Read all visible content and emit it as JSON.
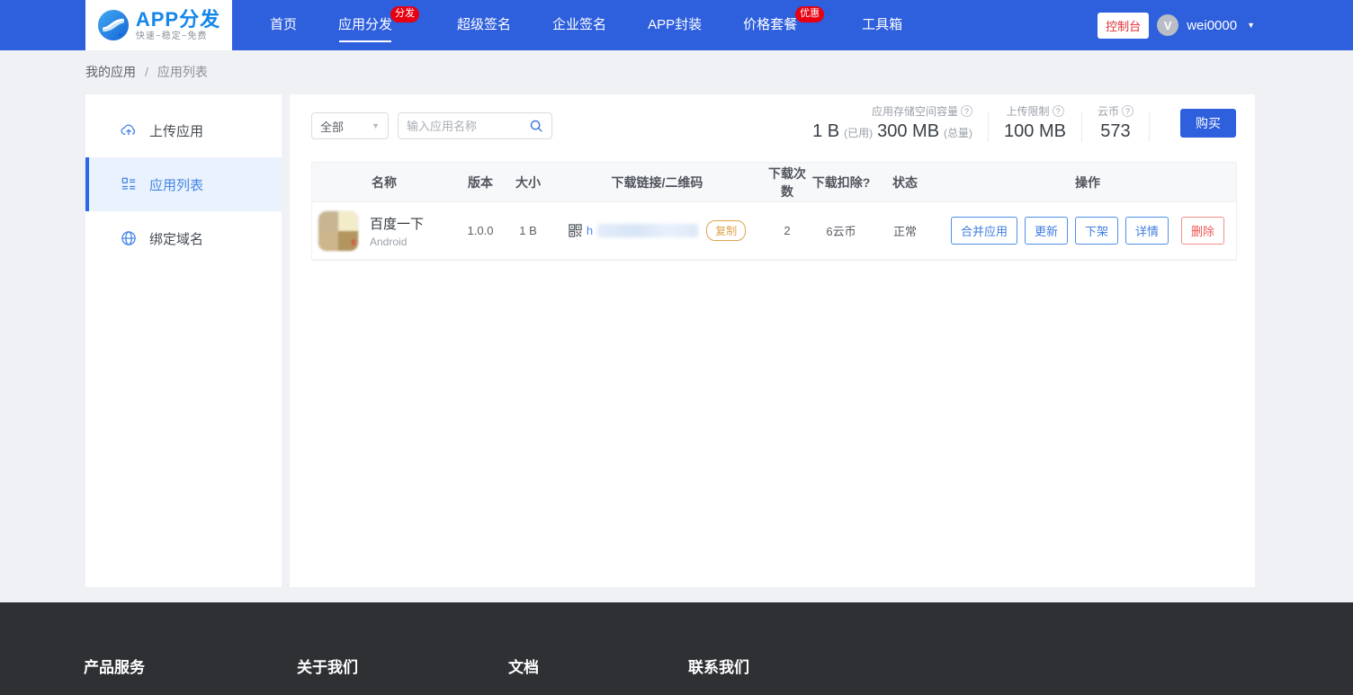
{
  "header": {
    "logo": {
      "title": "APP分发",
      "tagline": "快速~稳定~免费"
    },
    "nav": {
      "items": [
        {
          "label": "首页"
        },
        {
          "label": "应用分发",
          "badge": "分发"
        },
        {
          "label": "超级签名"
        },
        {
          "label": "企业签名"
        },
        {
          "label": "APP封装"
        },
        {
          "label": "价格套餐",
          "badge": "优惠"
        },
        {
          "label": "工具箱"
        }
      ]
    },
    "console_button": "控制台",
    "user": {
      "name": "wei0000",
      "avatar_initial": "V"
    }
  },
  "breadcrumb": {
    "current": "我的应用",
    "separator": "/",
    "page": "应用列表"
  },
  "sidebar": {
    "items": [
      {
        "label": "上传应用"
      },
      {
        "label": "应用列表"
      },
      {
        "label": "绑定域名"
      }
    ]
  },
  "toolbar": {
    "filter_selected": "全部",
    "search_placeholder": "输入应用名称"
  },
  "stats": {
    "storage_label": "应用存储空间容量",
    "used_value": "1 B",
    "used_suffix": "(已用)",
    "total_value": "300 MB",
    "total_suffix": "(总量)",
    "upload_limit_label": "上传限制",
    "upload_limit_value": "100 MB",
    "coin_label": "云币",
    "coin_value": "573",
    "buy_button": "购买"
  },
  "table": {
    "headers": [
      "名称",
      "版本",
      "大小",
      "下载链接/二维码",
      "下载次数",
      "下载扣除?",
      "状态",
      "操作"
    ],
    "rows": [
      {
        "name": "百度一下",
        "platform": "Android",
        "version": "1.0.0",
        "size": "1 B",
        "link_prefix": "h",
        "copy_button": "复制",
        "downloads": "2",
        "deduct": "6云币",
        "status": "正常",
        "actions": [
          "合并应用",
          "更新",
          "下架",
          "详情",
          "删除"
        ]
      }
    ]
  },
  "footer": {
    "columns": [
      "产品服务",
      "关于我们",
      "文档",
      "联系我们"
    ]
  },
  "colors": {
    "header_blue": "#2e5fdd",
    "accent_blue": "#3e7ee0",
    "badge_red": "#e60012",
    "danger_red": "#f25555",
    "copy_orange": "#dca550",
    "footer_dark": "#2e3033",
    "active_item_bg": "#e9f2fd"
  }
}
